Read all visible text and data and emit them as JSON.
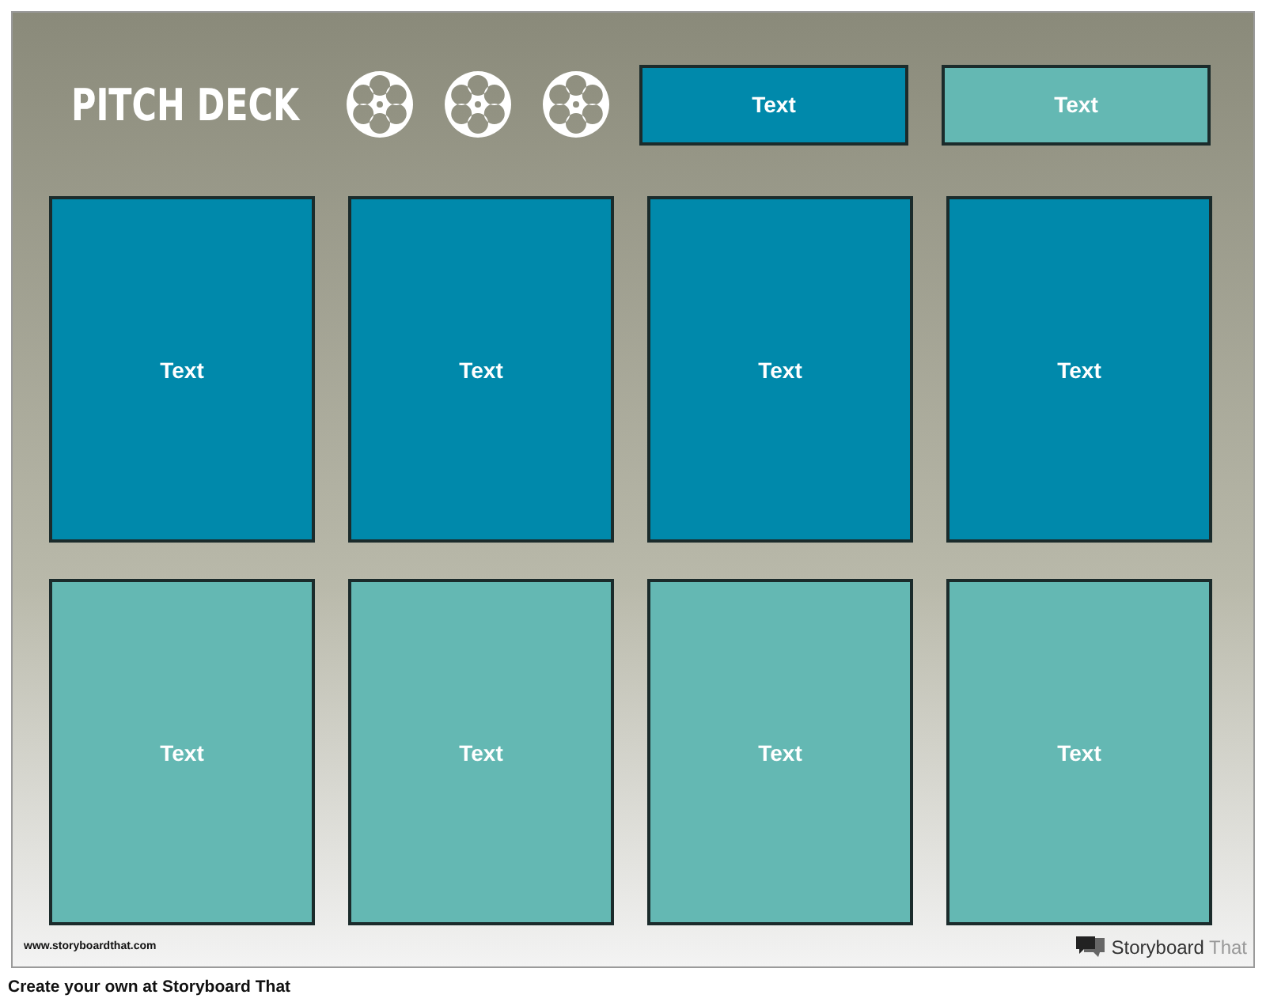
{
  "title": "PITCH DECK",
  "header_boxes": [
    {
      "text": "Text",
      "color": "#0089ab"
    },
    {
      "text": "Text",
      "color": "#64b8b3"
    }
  ],
  "panel_rows": [
    {
      "panels": [
        {
          "text": "Text",
          "color": "#0089ab"
        },
        {
          "text": "Text",
          "color": "#0089ab"
        },
        {
          "text": "Text",
          "color": "#0089ab"
        },
        {
          "text": "Text",
          "color": "#0089ab"
        }
      ]
    },
    {
      "panels": [
        {
          "text": "Text",
          "color": "#64b8b3"
        },
        {
          "text": "Text",
          "color": "#64b8b3"
        },
        {
          "text": "Text",
          "color": "#64b8b3"
        },
        {
          "text": "Text",
          "color": "#64b8b3"
        }
      ]
    }
  ],
  "footer": {
    "website": "www.storyboardthat.com",
    "brand": {
      "primary": "Storyboard",
      "secondary": "That"
    }
  },
  "caption": "Create your own at Storyboard That"
}
